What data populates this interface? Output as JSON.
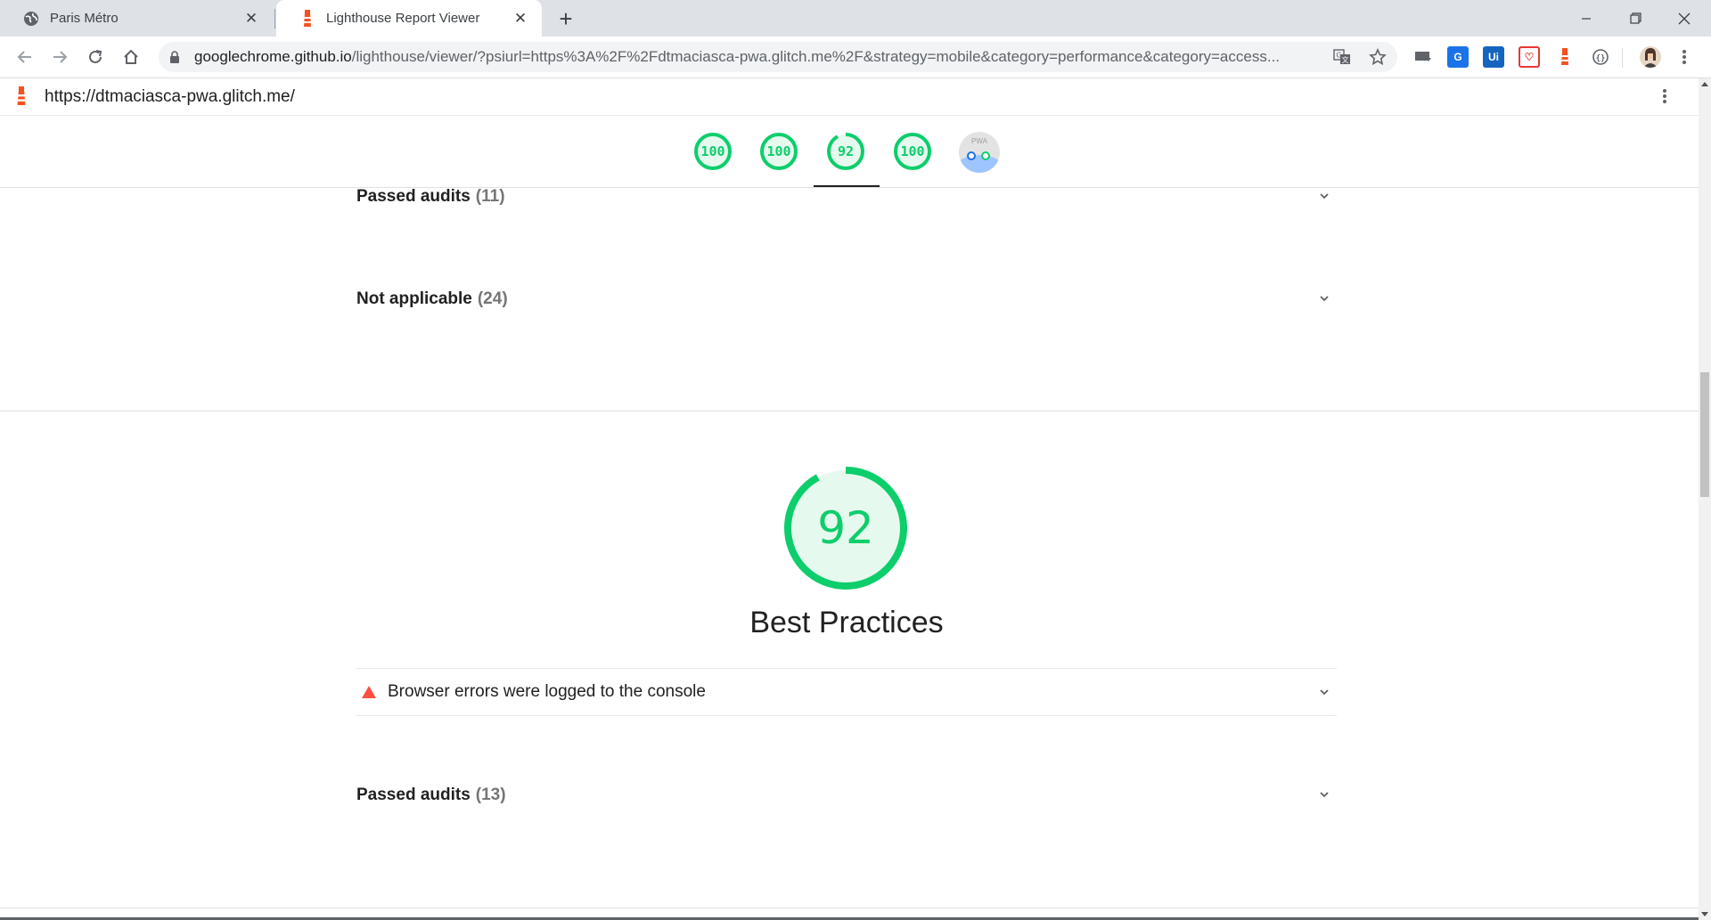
{
  "browser": {
    "tabs": [
      {
        "title": "Paris Métro",
        "icon": "globe-icon",
        "active": false
      },
      {
        "title": "Lighthouse Report Viewer",
        "icon": "lighthouse-icon",
        "active": true
      }
    ],
    "address": {
      "host": "googlechrome.github.io",
      "rest": "/lighthouse/viewer/?psiurl=https%3A%2F%2Fdtmaciasca-pwa.glitch.me%2F&strategy=mobile&category=performance&category=access..."
    }
  },
  "report": {
    "url": "https://dtmaciasca-pwa.glitch.me/",
    "gauges": [
      {
        "score": "100",
        "value": 100
      },
      {
        "score": "100",
        "value": 100
      },
      {
        "score": "92",
        "value": 92,
        "selected": true
      },
      {
        "score": "100",
        "value": 100
      }
    ],
    "pwa_badge_label": "PWA",
    "groups_top": [
      {
        "title": "Passed audits",
        "count": "(11)"
      },
      {
        "title": "Not applicable",
        "count": "(24)"
      }
    ],
    "category": {
      "score": "92",
      "value": 92,
      "title": "Best Practices",
      "failing_audit": "Browser errors were logged to the console",
      "passed": {
        "title": "Passed audits",
        "count": "(13)"
      }
    }
  },
  "colors": {
    "pass": "#0cce6b",
    "pass_bg": "#e6f9ef",
    "fail": "#ff4e42",
    "lighthouse": "#f4511e"
  }
}
